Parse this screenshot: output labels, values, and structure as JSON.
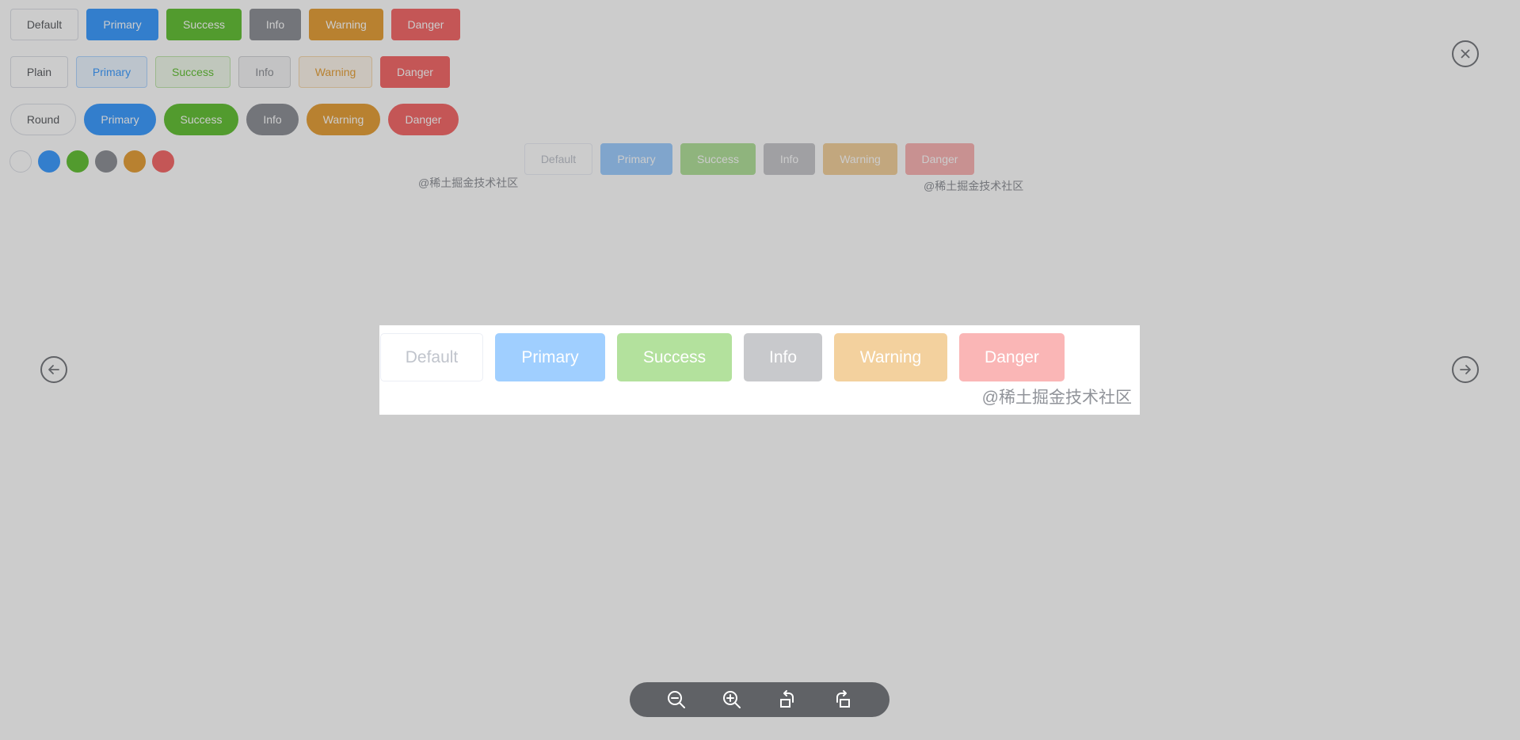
{
  "row1": [
    "Default",
    "Primary",
    "Success",
    "Info",
    "Warning",
    "Danger"
  ],
  "row2": [
    "Plain",
    "Primary",
    "Success",
    "Info",
    "Warning",
    "Danger"
  ],
  "row3": [
    "Round",
    "Primary",
    "Success",
    "Info",
    "Warning",
    "Danger"
  ],
  "disabled_row": [
    "Default",
    "Primary",
    "Success",
    "Info",
    "Warning",
    "Danger"
  ],
  "watermark": "@稀土掘金技术社区",
  "preview": {
    "buttons": [
      "Default",
      "Primary",
      "Success",
      "Info",
      "Warning",
      "Danger"
    ],
    "watermark": "@稀土掘金技术社区"
  },
  "viewer": {
    "close_icon": "close-icon",
    "prev_icon": "arrow-left-icon",
    "next_icon": "arrow-right-icon",
    "toolbar_icons": [
      "zoom-out-icon",
      "zoom-in-icon",
      "rotate-left-icon",
      "rotate-right-icon"
    ]
  }
}
